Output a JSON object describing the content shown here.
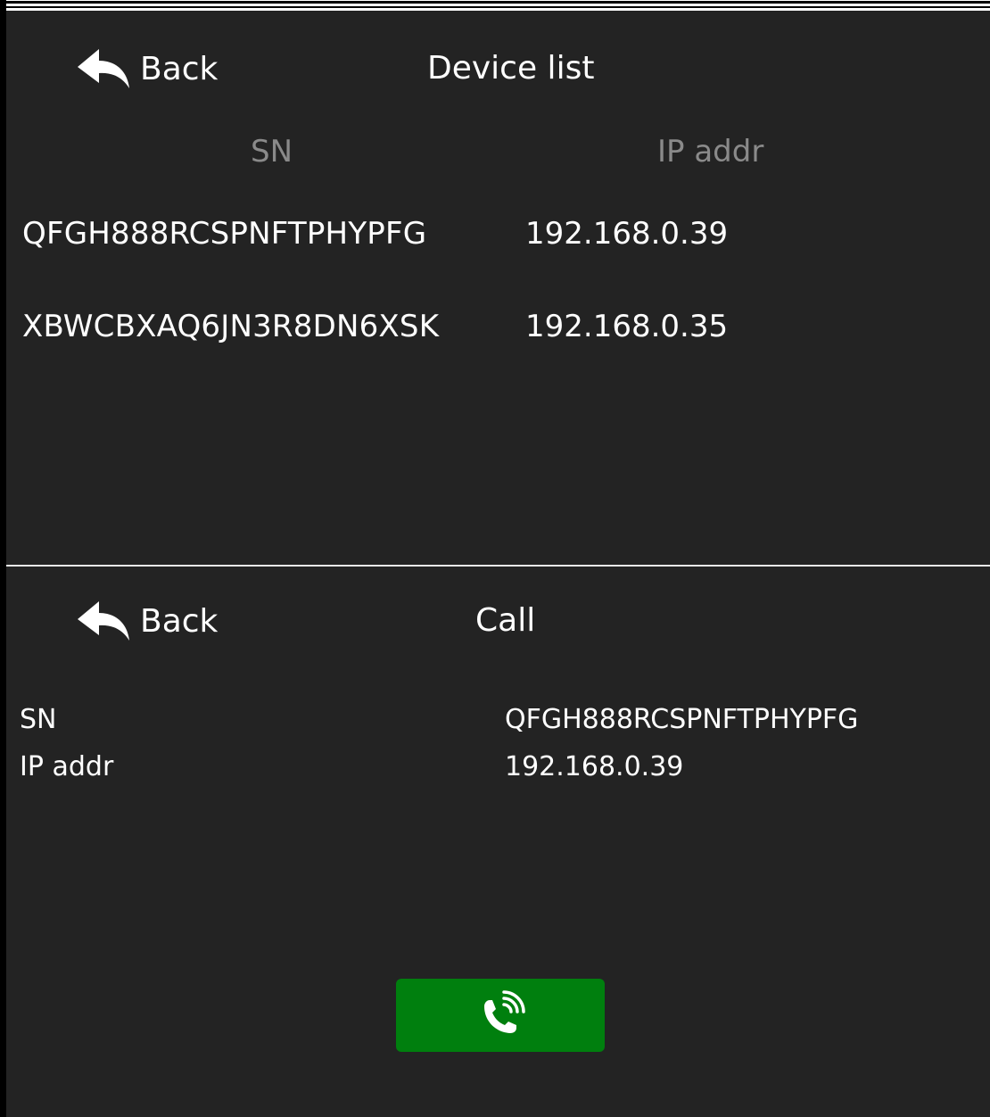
{
  "device_list": {
    "back_label": "Back",
    "title": "Device list",
    "columns": {
      "sn": "SN",
      "ip": "IP addr"
    },
    "devices": [
      {
        "sn": "QFGH888RCSPNFTPHYPFG",
        "ip": "192.168.0.39"
      },
      {
        "sn": "XBWCBXAQ6JN3R8DN6XSK",
        "ip": "192.168.0.35"
      }
    ]
  },
  "call_screen": {
    "back_label": "Back",
    "title": "Call",
    "sn_label": "SN",
    "sn_value": "QFGH888RCSPNFTPHYPFG",
    "ip_label": "IP addr",
    "ip_value": "192.168.0.39",
    "call_button_icon": "phone-call-icon",
    "call_button_color": "#007f0e"
  },
  "colors": {
    "background": "#232323",
    "text": "#ffffff",
    "header_text": "#8a8a8a"
  }
}
